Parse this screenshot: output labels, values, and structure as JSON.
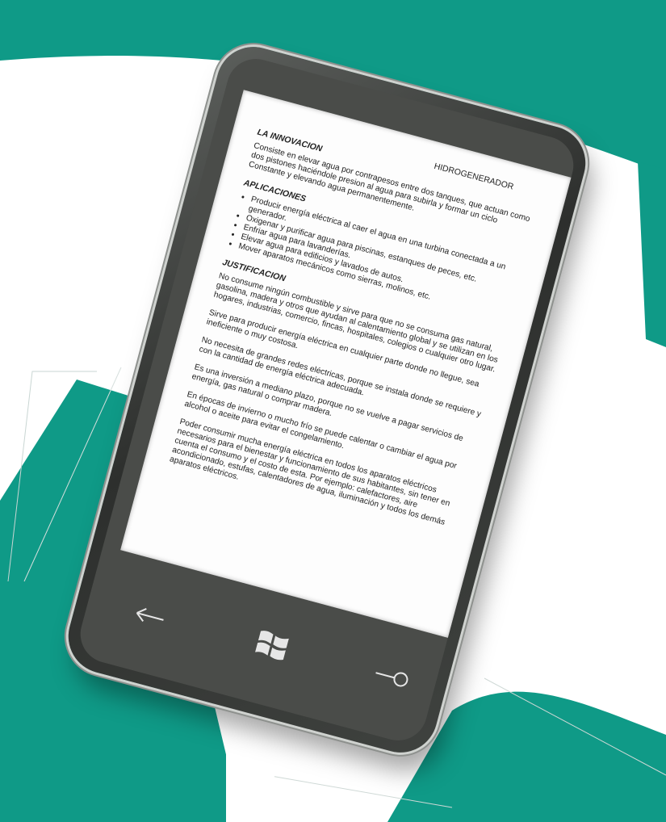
{
  "document": {
    "title": "HIDROGENERADOR",
    "sections": [
      {
        "heading": "LA INNOVACION",
        "paragraphs": [
          "Consiste en elevar agua por contrapesos entre dos tanques, que actuan como dos pistones haciéndole presion al agua para subirla y formar un ciclo Constante y elevando agua permanentemente."
        ]
      },
      {
        "heading": "APLICACIONES",
        "bullets": [
          "Producir energía eléctrica al caer el agua en una turbina conectada a un generador.",
          "Oxigenar y purificar agua para piscinas, estanques de peces, etc.",
          "Enfriar agua para lavanderías.",
          "Elevar agua para edificios y lavados de autos.",
          "Mover aparatos mecánicos como sierras, molinos, etc."
        ]
      },
      {
        "heading": "JUSTIFICACION",
        "paragraphs": [
          "No consume ningún combustible y sirve para que no se consuma gas natural, gasolina, madera y otros que ayudan al calentamiento global y se utilizan en los hogares, industrias, comercio, fincas, hospitales, colegios o cualquier otro lugar.",
          "Sirve para producir energía eléctrica en cualquier parte donde no llegue, sea ineficiente o muy costosa.",
          "No necesita de grandes redes eléctricas, porque se instala donde se requiere y con la cantidad de energía eléctrica adecuada.",
          "Es una inversión a mediano plazo, porque no se vuelve a pagar servicios de energía, gas natural o comprar madera.",
          "En épocas de invierno o mucho frío se puede calentar o cambiar el agua por alcohol o aceite para evitar el congelamiento.",
          "Poder consumir mucha energía eléctrica en todos los aparatos eléctricos necesarios para el bienestar y funcionamiento de sus habitantes, sin tener en cuenta el consumo y el costo de esta. Por ejemplo: calefactores, aire acondicionado, estufas, calentadores de agua, iluminación y todos los demás aparatos eléctricos."
        ]
      }
    ]
  },
  "icons": {
    "back": "back-arrow-icon",
    "start": "windows-logo-icon",
    "search": "search-icon"
  },
  "colors": {
    "teal": "#0f9a87",
    "phone_dark": "#3a3c39",
    "screen": "#fdfdfd"
  }
}
